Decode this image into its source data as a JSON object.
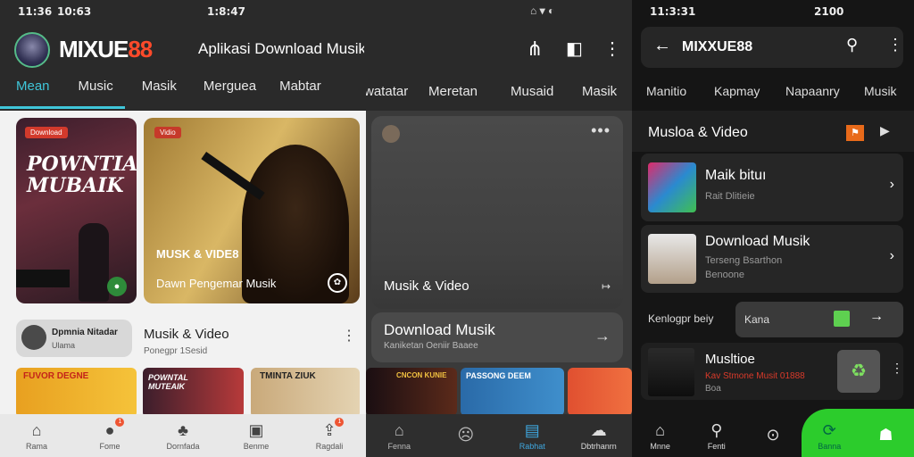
{
  "panel1": {
    "status": {
      "time": "11:36",
      "left": "10:63",
      "right": "1:8:47"
    },
    "app_name_a": "MIXUE",
    "app_name_b": "88",
    "title": "Aplikasi Download Musik Terbaik Musik",
    "tabs": [
      "Mean",
      "Music",
      "Masik",
      "Merguea",
      "Mabtar",
      "Pwatatar",
      "Meretan",
      "Musaid",
      "Masik"
    ],
    "hero_left": {
      "badge": "Download",
      "text": "POWNTIAL MUBAIK"
    },
    "hero_right": {
      "badge": "Vidio",
      "subtitle": "MUSK & VIDE8",
      "caption": "Dawn Pengemar Musik"
    },
    "row": {
      "chip": "Dpmnia Nitadar",
      "chip_sub": "Ulama",
      "title": "Musik & Video",
      "subtitle": "Ponegpr 1Sesid"
    },
    "thumbs": [
      "FUVOR DEGNE",
      "POWNTAL MUTEAIK",
      "TMINTA ZIUK"
    ],
    "nav": [
      {
        "icon": "⌂",
        "label": "Rama"
      },
      {
        "icon": "●",
        "label": "Fome",
        "badge": "1"
      },
      {
        "icon": "♣",
        "label": "Dornfada"
      },
      {
        "icon": "▣",
        "label": "Benme"
      },
      {
        "icon": "⇪",
        "label": "Ragdali",
        "badge": "1"
      }
    ]
  },
  "panel2": {
    "card_title": "Musik & Video",
    "download_title": "Download Musik",
    "download_sub": "Kaniketan Oeniir Baaee",
    "thumbs": [
      "CNCON KUNIE",
      "PASSONG DEEM",
      ""
    ],
    "nav": [
      {
        "icon": "⌂",
        "label": "Fenna"
      },
      {
        "icon": "☹",
        "label": ""
      },
      {
        "icon": "▤",
        "label": "Rabhat"
      },
      {
        "icon": "☁",
        "label": "Dbtrhanrn"
      }
    ]
  },
  "panel3": {
    "status": {
      "time": "11:3:31",
      "right": "2100"
    },
    "app_name": "MIXXUE88",
    "tabs": [
      "Manitio",
      "Kapmay",
      "Napaanry",
      "Musik"
    ],
    "section_title": "Musloa & Video",
    "rows": [
      {
        "title": "Maik bituı",
        "sub": "Rait Dlitieie"
      },
      {
        "title": "Download Musik",
        "sub": "Terseng Bsarthon",
        "sub2": "Benoone"
      }
    ],
    "bar_label": "Kenlogpr beiy",
    "bar_input": "Kana",
    "track": {
      "title": "Musltioe",
      "sub": "Kav Stmone Musit 01888",
      "sub2": "Boa"
    },
    "nav": [
      {
        "icon": "⌂",
        "label": "Mnne"
      },
      {
        "icon": "⚲",
        "label": "Fenti"
      },
      {
        "icon": "⊙",
        "label": ""
      },
      {
        "icon": "⟳",
        "label": "Banna"
      },
      {
        "icon": "☗",
        "label": ""
      }
    ]
  }
}
